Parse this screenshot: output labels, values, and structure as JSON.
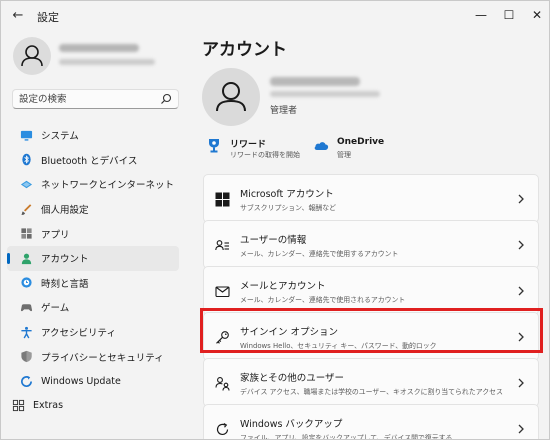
{
  "window": {
    "title": "設定",
    "back_icon": "←",
    "minimize_icon": "—",
    "maximize_icon": "☐",
    "close_icon": "✕"
  },
  "search": {
    "placeholder": "設定の検索"
  },
  "sidebar": {
    "items": [
      {
        "label": "システム",
        "icon": "monitor-icon",
        "active": false
      },
      {
        "label": "Bluetooth とデバイス",
        "icon": "bluetooth-icon",
        "active": false
      },
      {
        "label": "ネットワークとインターネット",
        "icon": "wifi-diamond-icon",
        "active": false
      },
      {
        "label": "個人用設定",
        "icon": "brush-icon",
        "active": false
      },
      {
        "label": "アプリ",
        "icon": "apps-icon",
        "active": false
      },
      {
        "label": "アカウント",
        "icon": "person-icon",
        "active": true
      },
      {
        "label": "時刻と言語",
        "icon": "globe-clock-icon",
        "active": false
      },
      {
        "label": "ゲーム",
        "icon": "gamepad-icon",
        "active": false
      },
      {
        "label": "アクセシビリティ",
        "icon": "accessibility-icon",
        "active": false
      },
      {
        "label": "プライバシーとセキュリティ",
        "icon": "shield-icon",
        "active": false
      },
      {
        "label": "Windows Update",
        "icon": "update-icon",
        "active": false
      },
      {
        "label": "Extras",
        "icon": "extras-grid-icon",
        "active": false
      }
    ]
  },
  "main": {
    "title": "アカウント",
    "role": "管理者",
    "services": {
      "rewards": {
        "title": "リワード",
        "subtitle": "リワードの取得を開始"
      },
      "onedrive": {
        "title": "OneDrive",
        "subtitle": "管理"
      }
    },
    "cards": [
      {
        "title": "Microsoft アカウント",
        "subtitle": "サブスクリプション、報酬など",
        "icon": "windows-logo-icon"
      },
      {
        "title": "ユーザーの情報",
        "subtitle": "メール、カレンダー、連絡先で使用するアカウント",
        "icon": "user-info-icon"
      },
      {
        "title": "メールとアカウント",
        "subtitle": "メール、カレンダー、連絡先で使用されるアカウント",
        "icon": "mail-icon"
      },
      {
        "title": "サインイン オプション",
        "subtitle": "Windows Hello、セキュリティ キー、パスワード、動的ロック",
        "icon": "key-icon"
      },
      {
        "title": "家族とその他のユーザー",
        "subtitle": "デバイス アクセス、職場または学校のユーザー、キオスクに割り当てられたアクセス",
        "icon": "family-icon"
      },
      {
        "title": "Windows バックアップ",
        "subtitle": "ファイル、アプリ、設定をバックアップして、デバイス間で復元する",
        "icon": "backup-icon"
      }
    ],
    "highlighted_card": "サインイン オプション"
  },
  "colors": {
    "accent": "#0067c0",
    "highlight": "#e02020"
  }
}
